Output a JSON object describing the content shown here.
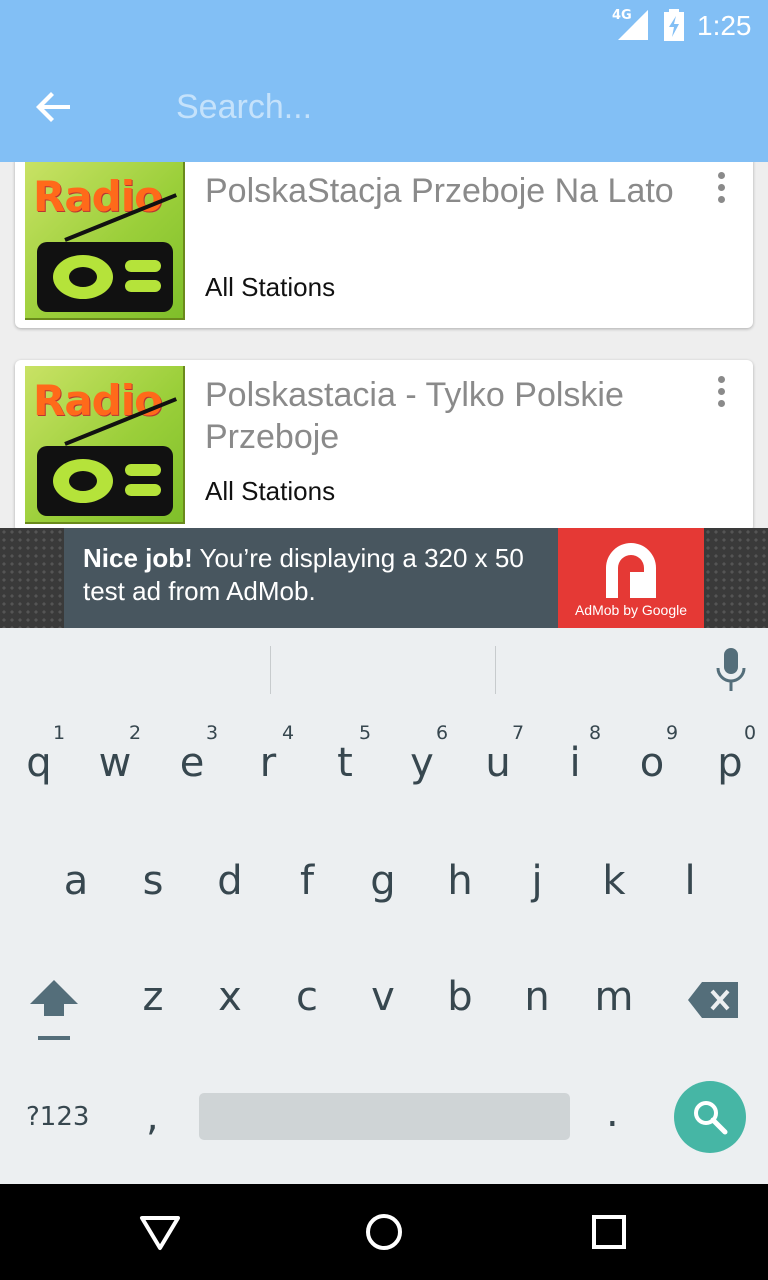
{
  "status_bar": {
    "network": "4G",
    "time": "1:25"
  },
  "search": {
    "placeholder": "Search...",
    "value": ""
  },
  "stations": [
    {
      "title": "PolskaStacja Przeboje Na Lato",
      "category": "All Stations",
      "thumb_text": "Radio"
    },
    {
      "title": "Polskastacia - Tylko Polskie Przeboje",
      "category": "All Stations",
      "thumb_text": "Radio"
    }
  ],
  "ad": {
    "headline": "Nice job!",
    "body": " You’re displaying a 320 x 50 test ad from AdMob.",
    "brand": "AdMob by Google"
  },
  "keyboard": {
    "row1": [
      {
        "key": "q",
        "hint": "1"
      },
      {
        "key": "w",
        "hint": "2"
      },
      {
        "key": "e",
        "hint": "3"
      },
      {
        "key": "r",
        "hint": "4"
      },
      {
        "key": "t",
        "hint": "5"
      },
      {
        "key": "y",
        "hint": "6"
      },
      {
        "key": "u",
        "hint": "7"
      },
      {
        "key": "i",
        "hint": "8"
      },
      {
        "key": "o",
        "hint": "9"
      },
      {
        "key": "p",
        "hint": "0"
      }
    ],
    "row2": [
      "a",
      "s",
      "d",
      "f",
      "g",
      "h",
      "j",
      "k",
      "l"
    ],
    "row3": [
      "z",
      "x",
      "c",
      "v",
      "b",
      "n",
      "m"
    ],
    "symbols_label": "?123",
    "comma": ",",
    "period": "."
  },
  "colors": {
    "app_bar": "#82bff5",
    "search_key": "#46b6a5",
    "ad_logo": "#e53935",
    "thumb_text": "#ff6a1a"
  },
  "icons": [
    "back-arrow-icon",
    "overflow-menu-icon",
    "mic-icon",
    "shift-icon",
    "backspace-icon",
    "search-icon",
    "nav-back-icon",
    "nav-home-icon",
    "nav-recents-icon",
    "battery-icon",
    "signal-icon"
  ]
}
